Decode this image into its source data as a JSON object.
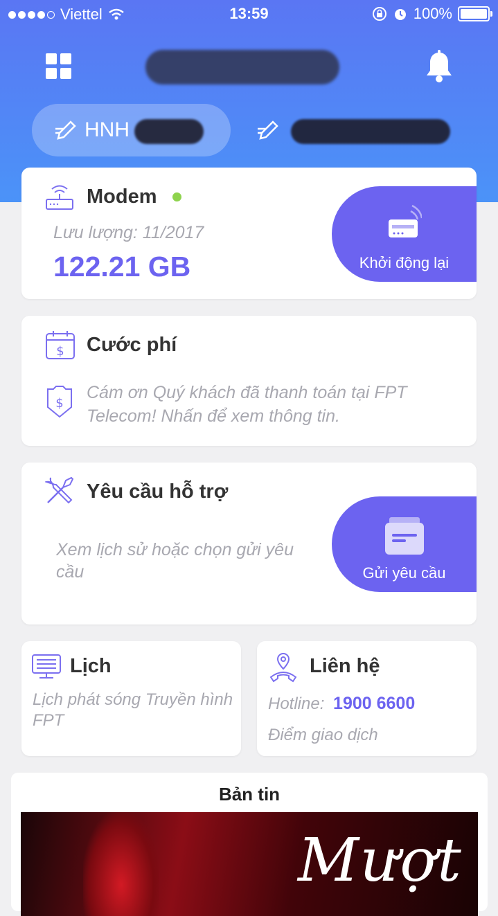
{
  "status_bar": {
    "carrier": "Viettel",
    "time": "13:59",
    "battery": "100%",
    "battery_level": 1.0,
    "signal_bars": 4
  },
  "header": {
    "account_1": "HNH",
    "account_2": ""
  },
  "modem_card": {
    "title": "Modem",
    "status_color": "#8ed34d",
    "usage_label": "Lưu lượng: 11/2017",
    "usage_value": "122.21 GB",
    "restart_label": "Khởi động lại"
  },
  "fee_card": {
    "title": "Cước phí",
    "message": "Cám ơn Quý khách đã thanh toán tại FPT Telecom! Nhấn để xem thông tin."
  },
  "support_card": {
    "title": "Yêu cầu hỗ trợ",
    "description": "Xem lịch sử hoặc chọn gửi yêu cầu",
    "send_label": "Gửi yêu cầu"
  },
  "schedule_card": {
    "title": "Lịch",
    "description": "Lịch phát sóng Truyền hình FPT"
  },
  "contact_card": {
    "title": "Liên hệ",
    "hotline_label": "Hotline:",
    "hotline_number": "1900 6600",
    "store_link": "Điểm giao dịch"
  },
  "news": {
    "title": "Bản tin",
    "banner_text": "Mượt"
  },
  "colors": {
    "accent": "#6c63f0",
    "header_gradient_top": "#5a76f3",
    "header_gradient_bottom": "#4b93f8",
    "icon_purple": "#7b6ff0"
  }
}
